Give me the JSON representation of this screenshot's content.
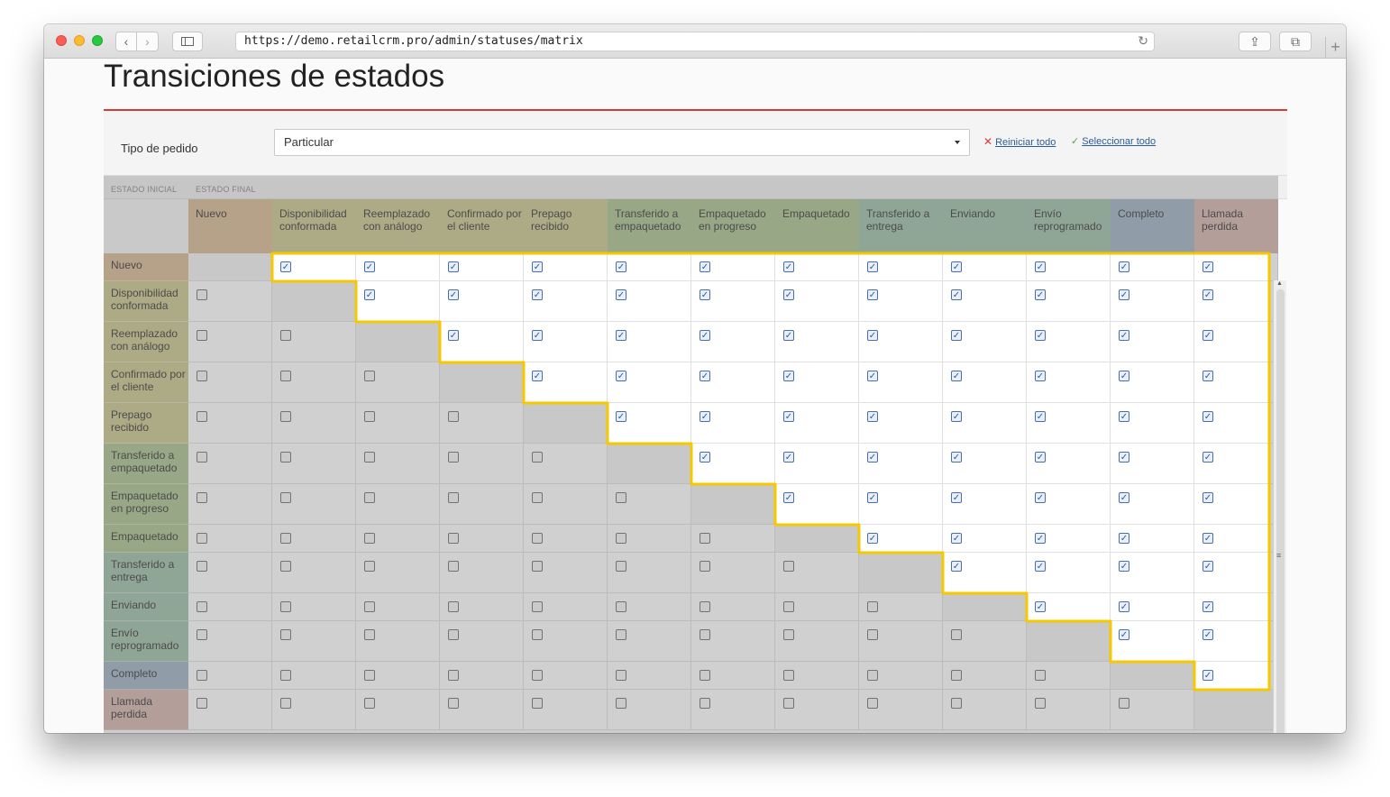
{
  "browser": {
    "url": "https://demo.retailcrm.pro/admin/statuses/matrix"
  },
  "page": {
    "title": "Transiciones de estados"
  },
  "filter": {
    "label": "Tipo de pedido",
    "selected": "Particular",
    "reset_label": "Reiniciar todo",
    "select_all_label": "Seleccionar todo"
  },
  "matrix": {
    "initial_label": "ESTADO INICIAL",
    "final_label": "ESTADO FINAL",
    "statuses": [
      {
        "name": "Nuevo",
        "color": "#d8b793"
      },
      {
        "name": "Disponibilidad conformada",
        "color": "#c9c78c"
      },
      {
        "name": "Reemplazado con análogo",
        "color": "#c9c78c"
      },
      {
        "name": "Confirmado por el cliente",
        "color": "#c9c78c"
      },
      {
        "name": "Prepago recibido",
        "color": "#c9c78c"
      },
      {
        "name": "Transferido a empaquetado",
        "color": "#a9c08c"
      },
      {
        "name": "Empaquetado en progreso",
        "color": "#a9c08c"
      },
      {
        "name": "Empaquetado",
        "color": "#a9c08c"
      },
      {
        "name": "Transferido a entrega",
        "color": "#9cbfa8"
      },
      {
        "name": "Enviando",
        "color": "#9cbfa8"
      },
      {
        "name": "Envío reprogramado",
        "color": "#9cbfa8"
      },
      {
        "name": "Completo",
        "color": "#9db1c2"
      },
      {
        "name": "Llamada perdida",
        "color": "#d4b3ad"
      }
    ]
  }
}
